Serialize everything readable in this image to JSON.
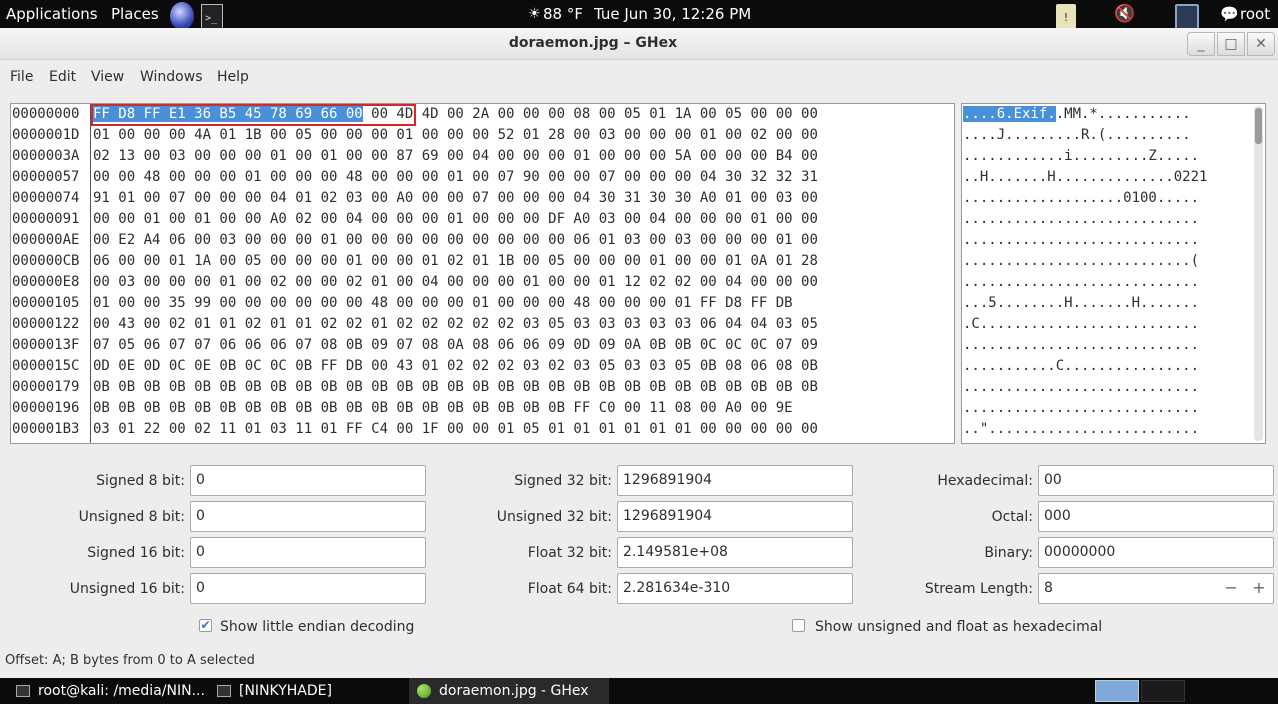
{
  "top_panel": {
    "applications": "Applications",
    "places": "Places",
    "weather_icon": "sun-cloud-icon",
    "weather": "88 °F",
    "clock": "Tue Jun 30, 12:26 PM",
    "user": "root"
  },
  "window": {
    "title": "doraemon.jpg – GHex",
    "minimize": "_",
    "maximize": "□",
    "close": "✕"
  },
  "menu": [
    "File",
    "Edit",
    "View",
    "Windows",
    "Help"
  ],
  "hex": {
    "offsets": [
      "00000000",
      "0000001D",
      "0000003A",
      "00000057",
      "00000074",
      "00000091",
      "000000AE",
      "000000CB",
      "000000E8",
      "00000105",
      "00000122",
      "0000013F",
      "0000015C",
      "00000179",
      "00000196",
      "000001B3"
    ],
    "selected_bytes": "FF D8 FF E1 36 B5 45 78 69 66 00",
    "first_row_rest": " 00 4D 4D 00 2A 00 00 00 08 00 05 01 1A 00 05 00 00 00",
    "rows": [
      "01 00 00 00 4A 01 1B 00 05 00 00 00 01 00 00 00 52 01 28 00 03 00 00 00 01 00 02 00 00",
      "02 13 00 03 00 00 00 01 00 01 00 00 87 69 00 04 00 00 00 01 00 00 00 5A 00 00 00 B4 00",
      "00 00 48 00 00 00 01 00 00 00 48 00 00 00 01 00 07 90 00 00 07 00 00 00 04 30 32 32 31",
      "91 01 00 07 00 00 00 04 01 02 03 00 A0 00 00 07 00 00 00 04 30 31 30 30 A0 01 00 03 00",
      "00 00 01 00 01 00 00 A0 02 00 04 00 00 00 01 00 00 00 DF A0 03 00 04 00 00 00 01 00 00",
      "00 E2 A4 06 00 03 00 00 00 01 00 00 00 00 00 00 00 00 00 06 01 03 00 03 00 00 00 01 00",
      "06 00 00 01 1A 00 05 00 00 00 01 00 00 01 02 01 1B 00 05 00 00 00 01 00 00 01 0A 01 28",
      "00 03 00 00 00 01 00 02 00 00 02 01 00 04 00 00 00 01 00 00 01 12 02 02 00 04 00 00 00",
      "01 00 00 35 99 00 00 00 00 00 00 48 00 00 00 01 00 00 00 48 00 00 00 01 FF D8 FF DB",
      "00 43 00 02 01 01 02 01 01 02 02 01 02 02 02 02 02 03 05 03 03 03 03 03 06 04 04 03 05",
      "07 05 06 07 07 06 06 06 07 08 0B 09 07 08 0A 08 06 06 09 0D 09 0A 0B 0B 0C 0C 0C 07 09",
      "0D 0E 0D 0C 0E 0B 0C 0C 0B FF DB 00 43 01 02 02 02 03 02 03 05 03 03 05 0B 08 06 08 0B",
      "0B 0B 0B 0B 0B 0B 0B 0B 0B 0B 0B 0B 0B 0B 0B 0B 0B 0B 0B 0B 0B 0B 0B 0B 0B 0B 0B 0B 0B",
      "0B 0B 0B 0B 0B 0B 0B 0B 0B 0B 0B 0B 0B 0B 0B 0B 0B 0B 0B FF C0 00 11 08 00 A0 00 9E",
      "03 01 22 00 02 11 01 03 11 01 FF C4 00 1F 00 00 01 05 01 01 01 01 01 01 00 00 00 00 00"
    ]
  },
  "ascii": {
    "selected": "....6.Exif.",
    "first_row_rest": ".MM.*...........",
    "rows": [
      "....J.........R.(..........",
      "............i.........Z.....",
      "..H.......H..............0221",
      "...................0100.....",
      "............................",
      "............................",
      "...........................(",
      "............................",
      "...5........H.......H.......",
      ".C..........................",
      "............................",
      "...........C................",
      "............................",
      "............................",
      "..\"........................."
    ]
  },
  "conversion": {
    "signed8_label": "Signed 8 bit:",
    "signed8": "0",
    "unsigned8_label": "Unsigned 8 bit:",
    "unsigned8": "0",
    "signed16_label": "Signed 16 bit:",
    "signed16": "0",
    "unsigned16_label": "Unsigned 16 bit:",
    "unsigned16": "0",
    "signed32_label": "Signed 32 bit:",
    "signed32": "1296891904",
    "unsigned32_label": "Unsigned 32 bit:",
    "unsigned32": "1296891904",
    "float32_label": "Float 32 bit:",
    "float32": "2.149581e+08",
    "float64_label": "Float 64 bit:",
    "float64": "2.281634e-310",
    "hex_label": "Hexadecimal:",
    "hex": "00",
    "octal_label": "Octal:",
    "octal": "000",
    "binary_label": "Binary:",
    "binary": "00000000",
    "stream_label": "Stream Length:",
    "stream": "8",
    "minus": "−",
    "plus": "+",
    "little_endian_label": "Show little endian decoding",
    "unsigned_hex_label": "Show unsigned and float as hexadecimal"
  },
  "status": "Offset: A; B bytes from 0 to A selected",
  "taskbar": {
    "task1": "root@kali: /media/NIN...",
    "task2": "[NINKYHADE]",
    "task3": "doraemon.jpg - GHex"
  }
}
